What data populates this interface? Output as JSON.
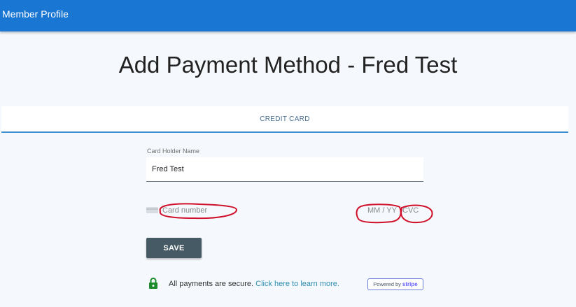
{
  "appbar": {
    "title": "Member Profile"
  },
  "page": {
    "title": "Add Payment Method - Fred Test"
  },
  "tabs": [
    {
      "label": "CREDIT CARD"
    }
  ],
  "form": {
    "card_holder": {
      "label": "Card Holder Name",
      "value": "Fred Test"
    },
    "card_number": {
      "placeholder": "Card number"
    },
    "expiry": {
      "placeholder": "MM / YY"
    },
    "cvc": {
      "placeholder": "CVC"
    },
    "save_label": "SAVE"
  },
  "secure": {
    "text": "All payments are secure. ",
    "link": "Click here to learn more."
  },
  "stripe_badge": {
    "prefix": "Powered by",
    "brand": "stripe"
  },
  "colors": {
    "appbar": "#1976d2",
    "tab_underline": "#3f8fd0",
    "save_button": "#455a64",
    "link": "#2f8fb2",
    "lock": "#1a8a2a",
    "annotation": "#d0102a"
  },
  "icons": [
    "card-brand-icon",
    "lock-icon"
  ]
}
